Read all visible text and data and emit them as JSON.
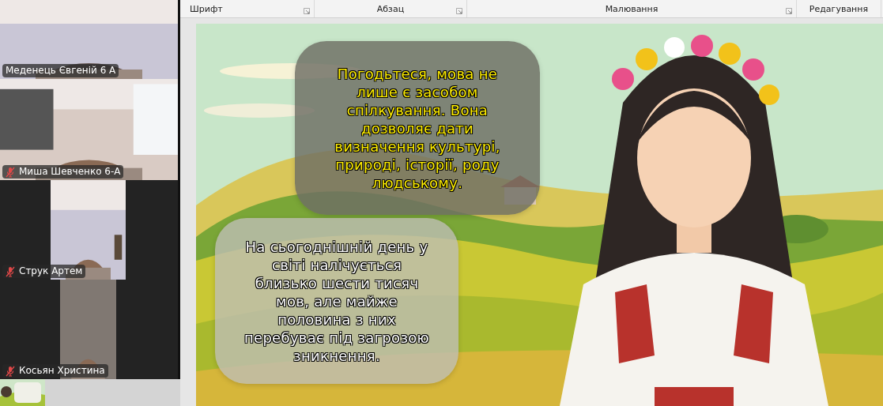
{
  "participants": [
    {
      "name": "Меденець Євгеній 6 А",
      "muted": false
    },
    {
      "name": "Миша Шевченко 6-А",
      "muted": true
    },
    {
      "name": "Струк Артем",
      "muted": true
    },
    {
      "name": "Косьян Христина",
      "muted": true
    }
  ],
  "ribbon": {
    "groups": [
      {
        "label": "Шрифт",
        "launcher": true
      },
      {
        "label": "Абзац",
        "launcher": true
      },
      {
        "label": "Малювання",
        "launcher": true
      },
      {
        "label": "Редагування",
        "launcher": false
      }
    ]
  },
  "slide": {
    "callouts": [
      {
        "kind": "highlight",
        "text": "Погодьтеся, мова не лише є засобом спілкування. Вона дозволяє дати визначення культурі, природі, історії, роду людському."
      },
      {
        "kind": "plain",
        "text": "На сьогоднішній день у світі налічується близько шести тисяч мов, але майже половина з них перебуває під загрозою зникнення."
      }
    ]
  }
}
